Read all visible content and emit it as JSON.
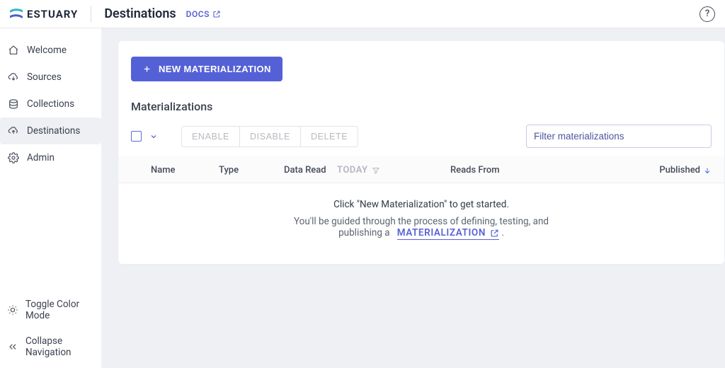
{
  "brand": {
    "name": "ESTUARY"
  },
  "header": {
    "title": "Destinations",
    "docs_label": "DOCS"
  },
  "sidebar": {
    "items": [
      {
        "label": "Welcome"
      },
      {
        "label": "Sources"
      },
      {
        "label": "Collections"
      },
      {
        "label": "Destinations"
      },
      {
        "label": "Admin"
      }
    ],
    "bottom": [
      {
        "label": "Toggle Color Mode"
      },
      {
        "label": "Collapse Navigation"
      }
    ]
  },
  "main": {
    "new_button": "NEW MATERIALIZATION",
    "section_title": "Materializations",
    "filter_placeholder": "Filter materializations",
    "actions": {
      "enable": "ENABLE",
      "disable": "DISABLE",
      "delete": "DELETE"
    },
    "columns": {
      "name": "Name",
      "type": "Type",
      "data_read": "Data Read",
      "today": "TODAY",
      "reads_from": "Reads From",
      "published": "Published"
    },
    "empty": {
      "line1": "Click \"New Materialization\" to get started.",
      "line2_prefix": "You'll be guided through the process of defining, testing, and",
      "line2_mid": "publishing a",
      "materialization_link": "MATERIALIZATION",
      "line2_suffix": "."
    }
  }
}
